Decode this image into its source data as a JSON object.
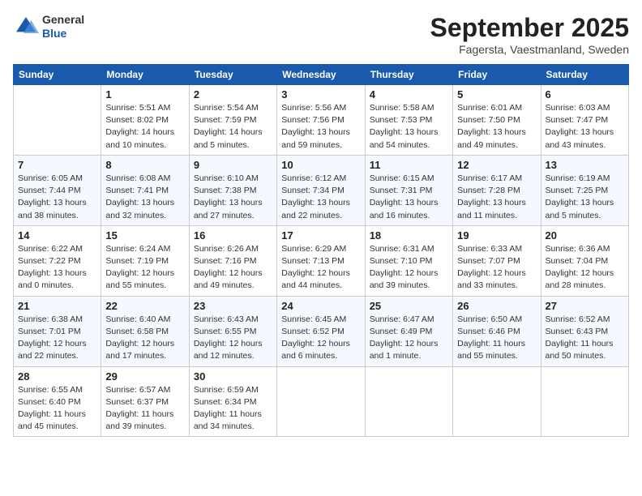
{
  "header": {
    "logo_general": "General",
    "logo_blue": "Blue",
    "month_title": "September 2025",
    "location": "Fagersta, Vaestmanland, Sweden"
  },
  "columns": [
    "Sunday",
    "Monday",
    "Tuesday",
    "Wednesday",
    "Thursday",
    "Friday",
    "Saturday"
  ],
  "weeks": [
    [
      {
        "day": "",
        "sunrise": "",
        "sunset": "",
        "daylight": ""
      },
      {
        "day": "1",
        "sunrise": "Sunrise: 5:51 AM",
        "sunset": "Sunset: 8:02 PM",
        "daylight": "Daylight: 14 hours and 10 minutes."
      },
      {
        "day": "2",
        "sunrise": "Sunrise: 5:54 AM",
        "sunset": "Sunset: 7:59 PM",
        "daylight": "Daylight: 14 hours and 5 minutes."
      },
      {
        "day": "3",
        "sunrise": "Sunrise: 5:56 AM",
        "sunset": "Sunset: 7:56 PM",
        "daylight": "Daylight: 13 hours and 59 minutes."
      },
      {
        "day": "4",
        "sunrise": "Sunrise: 5:58 AM",
        "sunset": "Sunset: 7:53 PM",
        "daylight": "Daylight: 13 hours and 54 minutes."
      },
      {
        "day": "5",
        "sunrise": "Sunrise: 6:01 AM",
        "sunset": "Sunset: 7:50 PM",
        "daylight": "Daylight: 13 hours and 49 minutes."
      },
      {
        "day": "6",
        "sunrise": "Sunrise: 6:03 AM",
        "sunset": "Sunset: 7:47 PM",
        "daylight": "Daylight: 13 hours and 43 minutes."
      }
    ],
    [
      {
        "day": "7",
        "sunrise": "Sunrise: 6:05 AM",
        "sunset": "Sunset: 7:44 PM",
        "daylight": "Daylight: 13 hours and 38 minutes."
      },
      {
        "day": "8",
        "sunrise": "Sunrise: 6:08 AM",
        "sunset": "Sunset: 7:41 PM",
        "daylight": "Daylight: 13 hours and 32 minutes."
      },
      {
        "day": "9",
        "sunrise": "Sunrise: 6:10 AM",
        "sunset": "Sunset: 7:38 PM",
        "daylight": "Daylight: 13 hours and 27 minutes."
      },
      {
        "day": "10",
        "sunrise": "Sunrise: 6:12 AM",
        "sunset": "Sunset: 7:34 PM",
        "daylight": "Daylight: 13 hours and 22 minutes."
      },
      {
        "day": "11",
        "sunrise": "Sunrise: 6:15 AM",
        "sunset": "Sunset: 7:31 PM",
        "daylight": "Daylight: 13 hours and 16 minutes."
      },
      {
        "day": "12",
        "sunrise": "Sunrise: 6:17 AM",
        "sunset": "Sunset: 7:28 PM",
        "daylight": "Daylight: 13 hours and 11 minutes."
      },
      {
        "day": "13",
        "sunrise": "Sunrise: 6:19 AM",
        "sunset": "Sunset: 7:25 PM",
        "daylight": "Daylight: 13 hours and 5 minutes."
      }
    ],
    [
      {
        "day": "14",
        "sunrise": "Sunrise: 6:22 AM",
        "sunset": "Sunset: 7:22 PM",
        "daylight": "Daylight: 13 hours and 0 minutes."
      },
      {
        "day": "15",
        "sunrise": "Sunrise: 6:24 AM",
        "sunset": "Sunset: 7:19 PM",
        "daylight": "Daylight: 12 hours and 55 minutes."
      },
      {
        "day": "16",
        "sunrise": "Sunrise: 6:26 AM",
        "sunset": "Sunset: 7:16 PM",
        "daylight": "Daylight: 12 hours and 49 minutes."
      },
      {
        "day": "17",
        "sunrise": "Sunrise: 6:29 AM",
        "sunset": "Sunset: 7:13 PM",
        "daylight": "Daylight: 12 hours and 44 minutes."
      },
      {
        "day": "18",
        "sunrise": "Sunrise: 6:31 AM",
        "sunset": "Sunset: 7:10 PM",
        "daylight": "Daylight: 12 hours and 39 minutes."
      },
      {
        "day": "19",
        "sunrise": "Sunrise: 6:33 AM",
        "sunset": "Sunset: 7:07 PM",
        "daylight": "Daylight: 12 hours and 33 minutes."
      },
      {
        "day": "20",
        "sunrise": "Sunrise: 6:36 AM",
        "sunset": "Sunset: 7:04 PM",
        "daylight": "Daylight: 12 hours and 28 minutes."
      }
    ],
    [
      {
        "day": "21",
        "sunrise": "Sunrise: 6:38 AM",
        "sunset": "Sunset: 7:01 PM",
        "daylight": "Daylight: 12 hours and 22 minutes."
      },
      {
        "day": "22",
        "sunrise": "Sunrise: 6:40 AM",
        "sunset": "Sunset: 6:58 PM",
        "daylight": "Daylight: 12 hours and 17 minutes."
      },
      {
        "day": "23",
        "sunrise": "Sunrise: 6:43 AM",
        "sunset": "Sunset: 6:55 PM",
        "daylight": "Daylight: 12 hours and 12 minutes."
      },
      {
        "day": "24",
        "sunrise": "Sunrise: 6:45 AM",
        "sunset": "Sunset: 6:52 PM",
        "daylight": "Daylight: 12 hours and 6 minutes."
      },
      {
        "day": "25",
        "sunrise": "Sunrise: 6:47 AM",
        "sunset": "Sunset: 6:49 PM",
        "daylight": "Daylight: 12 hours and 1 minute."
      },
      {
        "day": "26",
        "sunrise": "Sunrise: 6:50 AM",
        "sunset": "Sunset: 6:46 PM",
        "daylight": "Daylight: 11 hours and 55 minutes."
      },
      {
        "day": "27",
        "sunrise": "Sunrise: 6:52 AM",
        "sunset": "Sunset: 6:43 PM",
        "daylight": "Daylight: 11 hours and 50 minutes."
      }
    ],
    [
      {
        "day": "28",
        "sunrise": "Sunrise: 6:55 AM",
        "sunset": "Sunset: 6:40 PM",
        "daylight": "Daylight: 11 hours and 45 minutes."
      },
      {
        "day": "29",
        "sunrise": "Sunrise: 6:57 AM",
        "sunset": "Sunset: 6:37 PM",
        "daylight": "Daylight: 11 hours and 39 minutes."
      },
      {
        "day": "30",
        "sunrise": "Sunrise: 6:59 AM",
        "sunset": "Sunset: 6:34 PM",
        "daylight": "Daylight: 11 hours and 34 minutes."
      },
      {
        "day": "",
        "sunrise": "",
        "sunset": "",
        "daylight": ""
      },
      {
        "day": "",
        "sunrise": "",
        "sunset": "",
        "daylight": ""
      },
      {
        "day": "",
        "sunrise": "",
        "sunset": "",
        "daylight": ""
      },
      {
        "day": "",
        "sunrise": "",
        "sunset": "",
        "daylight": ""
      }
    ]
  ]
}
